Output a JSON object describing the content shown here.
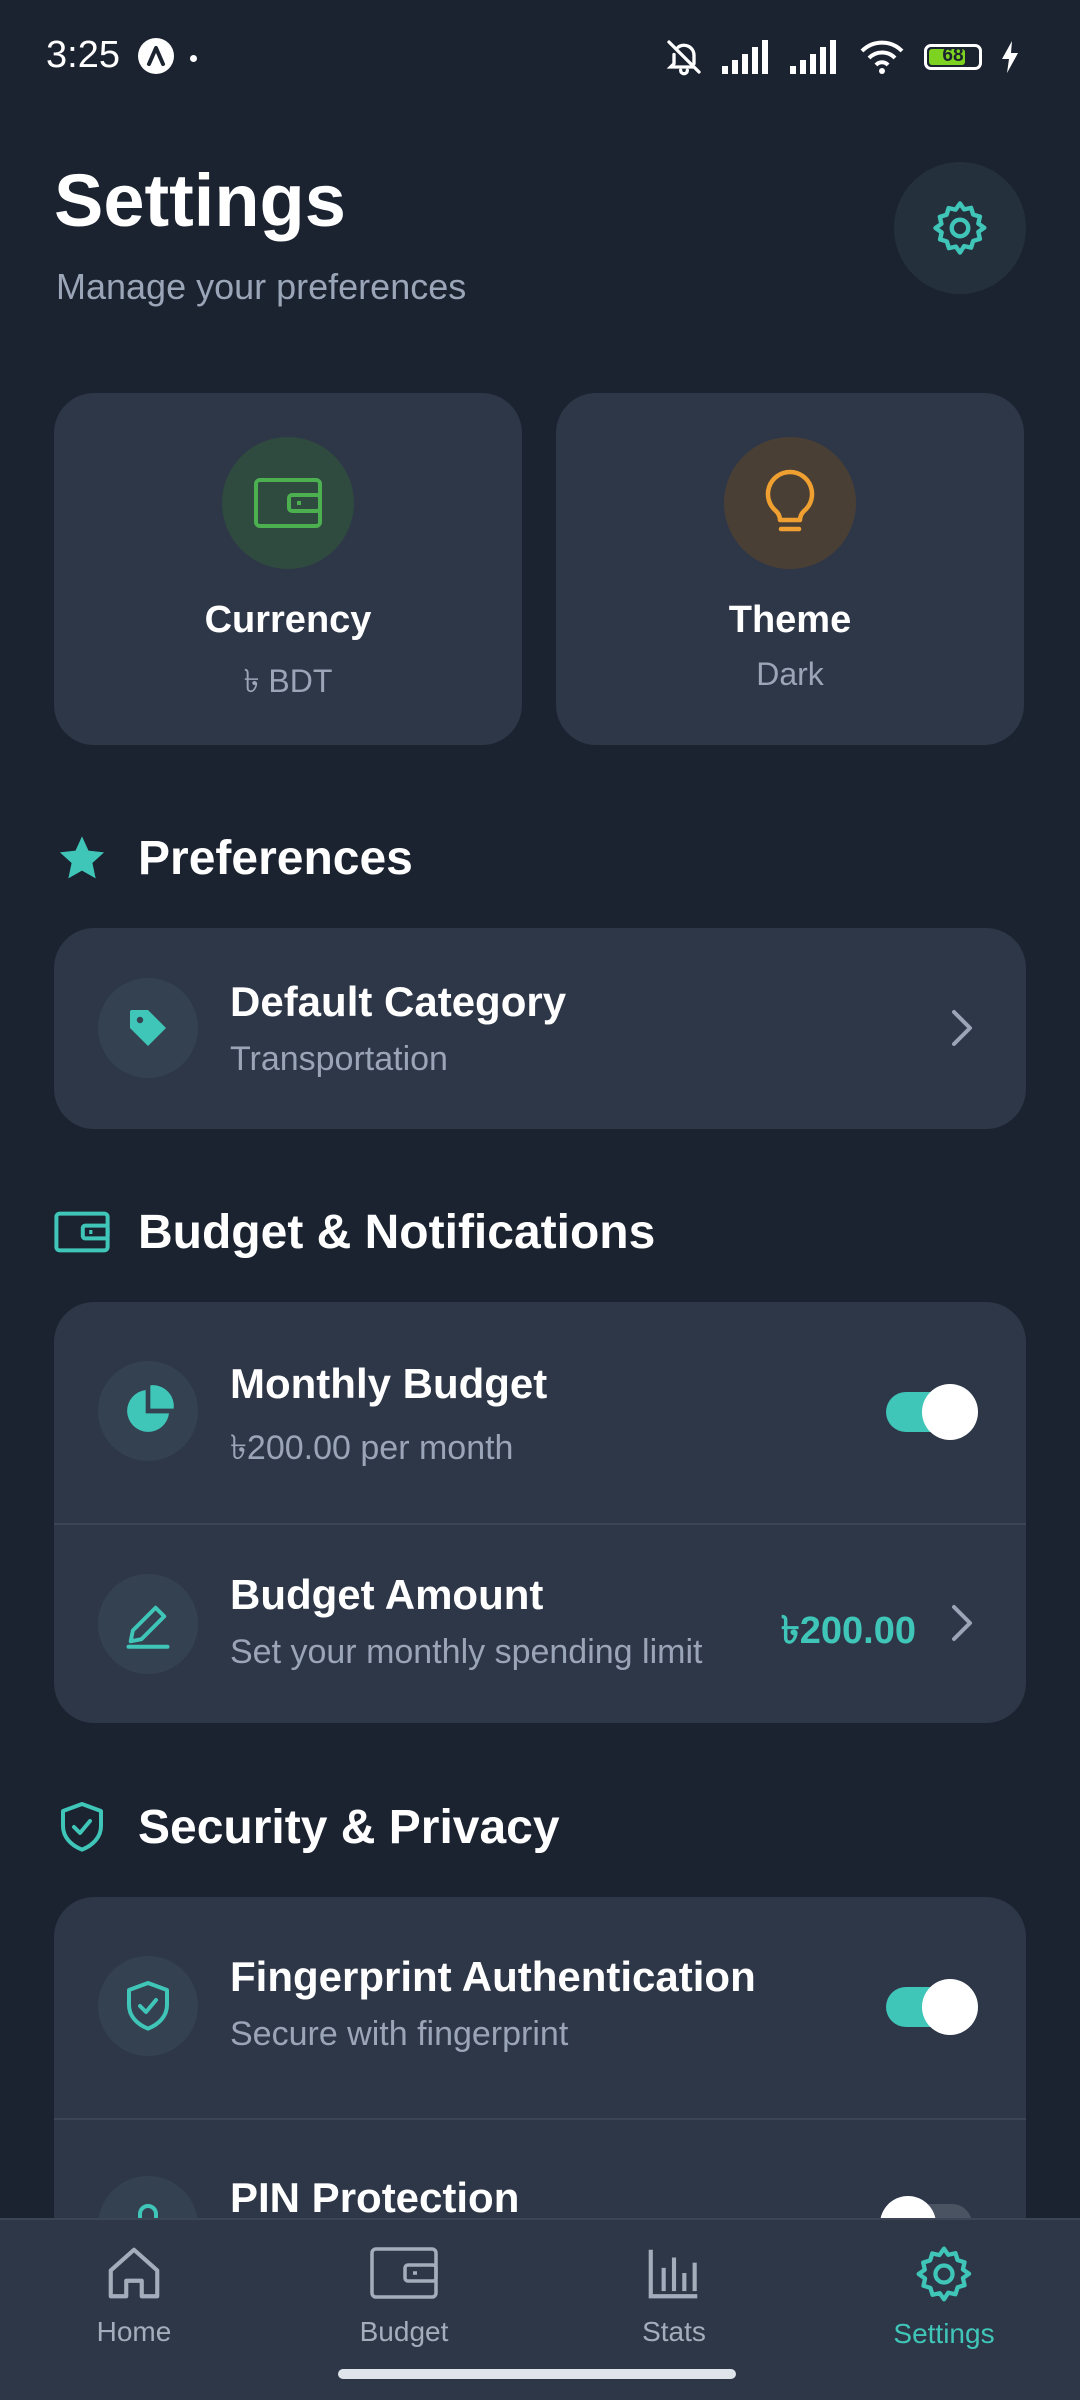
{
  "status_bar": {
    "time": "3:25",
    "battery": "68",
    "icons": [
      "notifications-off-icon",
      "signal-icon",
      "signal-icon",
      "wifi-icon",
      "battery-icon",
      "charging-icon"
    ]
  },
  "header": {
    "title": "Settings",
    "subtitle": "Manage your preferences"
  },
  "tiles": {
    "currency": {
      "label": "Currency",
      "value": "৳ BDT",
      "icon": "wallet-icon",
      "color": "#4caf50"
    },
    "theme": {
      "label": "Theme",
      "value": "Dark",
      "icon": "lightbulb-icon",
      "color": "#f0a030"
    }
  },
  "sections": {
    "preferences": {
      "title": "Preferences",
      "rows": [
        {
          "title": "Default Category",
          "subtitle": "Transportation",
          "icon": "tag-icon"
        }
      ]
    },
    "budget": {
      "title": "Budget & Notifications",
      "rows": [
        {
          "title": "Monthly Budget",
          "subtitle": "৳200.00 per month",
          "icon": "pie-chart-icon",
          "toggle": true
        },
        {
          "title": "Budget Amount",
          "subtitle": "Set your monthly spending limit",
          "value": "৳200.00",
          "icon": "pencil-icon"
        }
      ]
    },
    "security": {
      "title": "Security & Privacy",
      "rows": [
        {
          "title": "Fingerprint Authentication",
          "subtitle": "Secure with fingerprint",
          "icon": "shield-check-icon",
          "toggle": true
        },
        {
          "title": "PIN Protection",
          "icon": "lock-icon",
          "toggle": false
        }
      ]
    }
  },
  "nav": {
    "items": [
      {
        "label": "Home",
        "icon": "home-icon"
      },
      {
        "label": "Budget",
        "icon": "wallet-icon"
      },
      {
        "label": "Stats",
        "icon": "bar-chart-icon"
      },
      {
        "label": "Settings",
        "icon": "gear-icon",
        "active": true
      }
    ]
  },
  "colors": {
    "background": "#1b2230",
    "card": "#2e3748",
    "accent": "#3fc6b8",
    "muted_text": "#9aa6b8"
  }
}
